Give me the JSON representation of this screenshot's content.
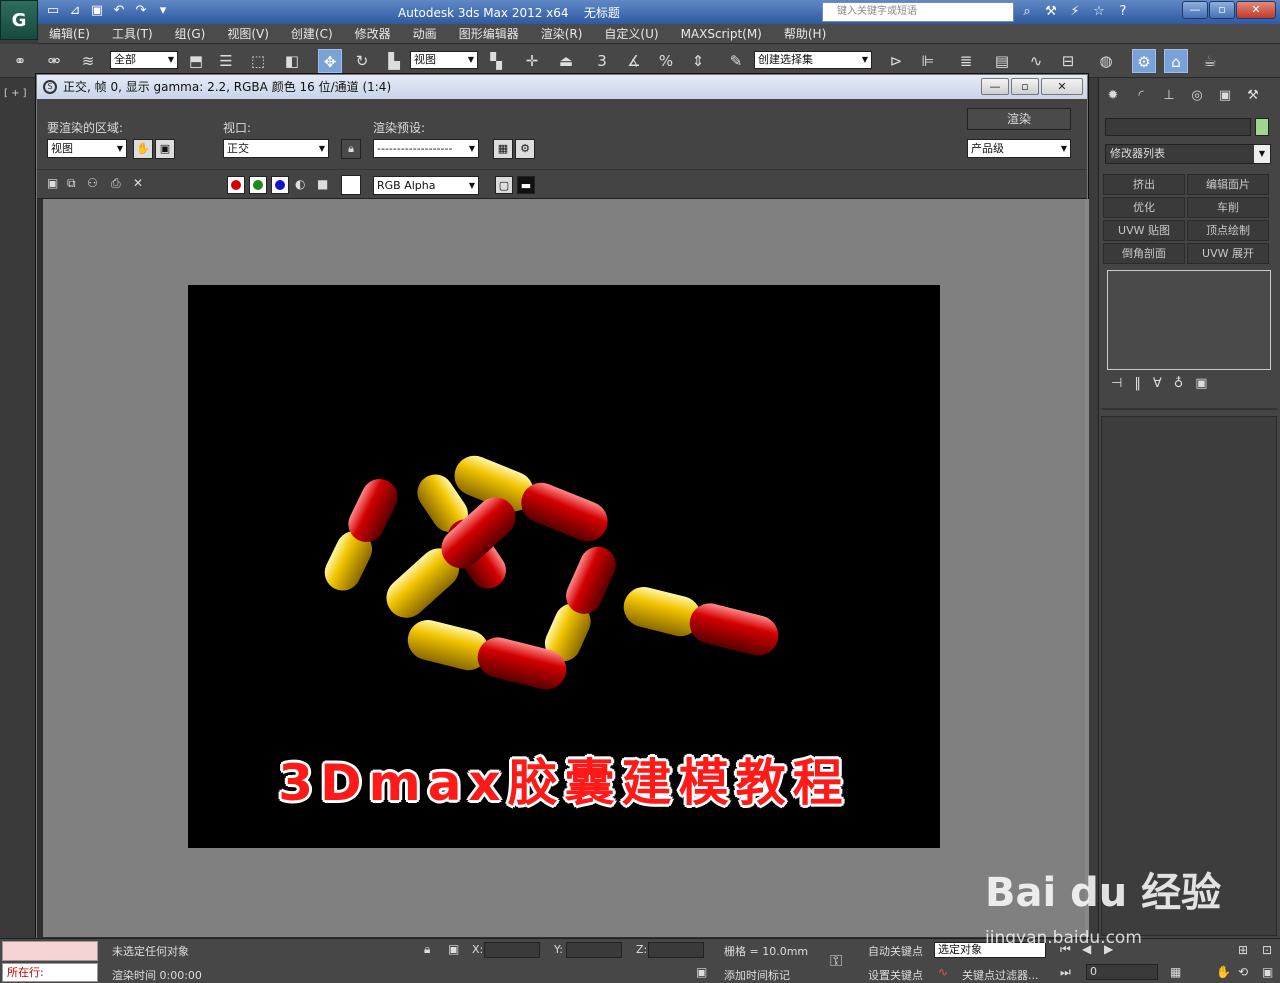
{
  "app": {
    "title": "Autodesk 3ds Max  2012 x64",
    "doc": "无标题",
    "search_placeholder": "键入关键字或短语"
  },
  "menu": [
    "编辑(E)",
    "工具(T)",
    "组(G)",
    "视图(V)",
    "创建(C)",
    "修改器",
    "动画",
    "图形编辑器",
    "渲染(R)",
    "自定义(U)",
    "MAXScript(M)",
    "帮助(H)"
  ],
  "toolbar": {
    "filter": "全部",
    "refcoord": "视图",
    "snap_num": "3",
    "selection_set": "创建选择集"
  },
  "viewport": {
    "label": "[ + ]"
  },
  "render_frame": {
    "title": "正交, 帧 0, 显示 gamma: 2.2, RGBA 颜色 16 位/通道 (1:4)",
    "area_label": "要渲染的区域:",
    "area_value": "视图",
    "viewport_label": "视口:",
    "viewport_value": "正交",
    "preset_label": "渲染预设:",
    "preset_value": "-------------------",
    "render_button": "渲染",
    "production_value": "产品级",
    "channel_value": "RGB Alpha",
    "caption": "3Dmax胶囊建模教程"
  },
  "command_panel": {
    "modifier_list": "修改器列表",
    "modifier_buttons": [
      "挤出",
      "编辑面片",
      "优化",
      "车削",
      "UVW 贴图",
      "顶点绘制",
      "倒角剖面",
      "UVW 展开"
    ]
  },
  "status": {
    "selection_msg": "未选定任何对象",
    "render_time": "渲染时间  0:00:00",
    "running": "所在行:",
    "x_label": "X:",
    "y_label": "Y:",
    "z_label": "Z:",
    "grid": "栅格 = 10.0mm",
    "autokey": "自动关键点",
    "setkey": "设置关键点",
    "selected": "选定对象",
    "key_filter": "关键点过滤器...",
    "add_time_tag": "添加时间标记",
    "frame_value": "0"
  },
  "watermark": {
    "logo": "Bai du 经验",
    "url": "jingyan.baidu.com"
  },
  "colors": {
    "capsule_red": "#d40000",
    "capsule_yellow": "#f2c400",
    "caption": "#ff1a1a"
  },
  "icons": [
    "undo-icon",
    "redo-icon",
    "save-icon",
    "open-icon",
    "new-icon",
    "link-icon",
    "select-icon",
    "move-icon",
    "rotate-icon",
    "scale-icon",
    "render-icon",
    "teapot-icon",
    "lock-icon",
    "close-icon",
    "minimize-icon",
    "maximize-icon",
    "help-icon",
    "star-icon",
    "search-icon"
  ]
}
